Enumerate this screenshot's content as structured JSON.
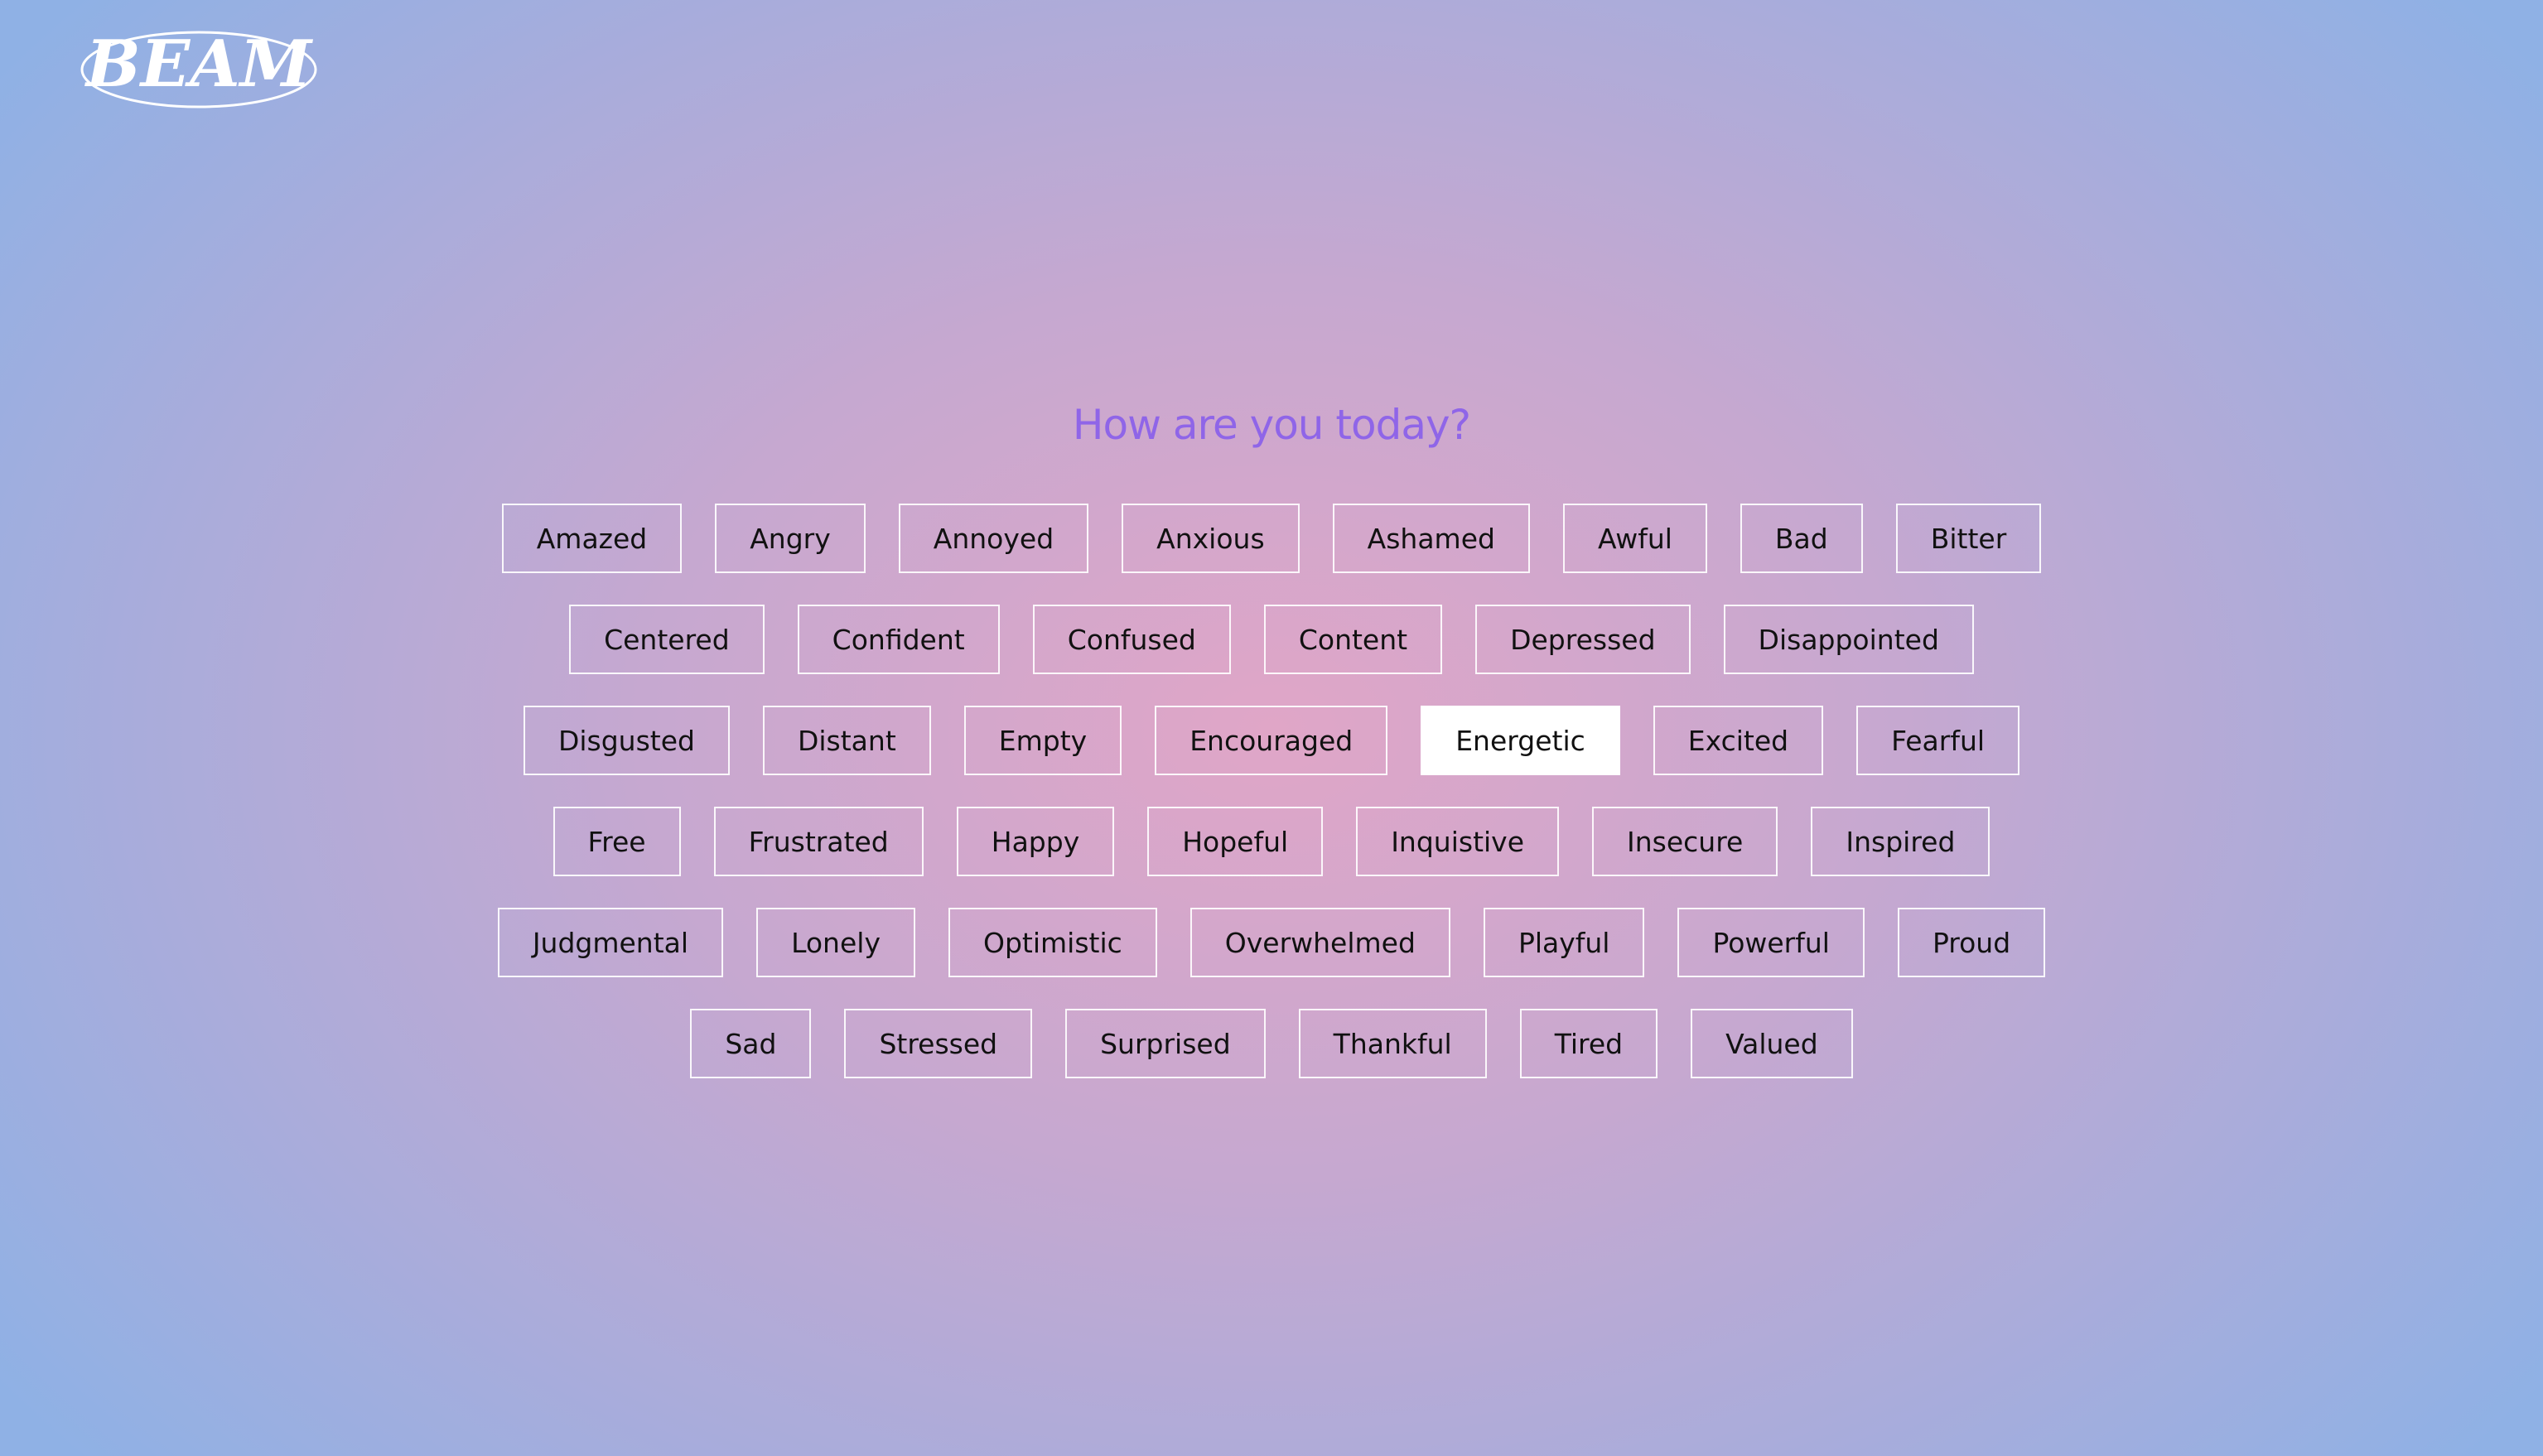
{
  "logo": {
    "text": "BEAM"
  },
  "question": "How are you today?",
  "emotion_rows": [
    [
      {
        "label": "Amazed"
      },
      {
        "label": "Angry"
      },
      {
        "label": "Annoyed"
      },
      {
        "label": "Anxious"
      },
      {
        "label": "Ashamed"
      },
      {
        "label": "Awful"
      },
      {
        "label": "Bad"
      },
      {
        "label": "Bitter"
      }
    ],
    [
      {
        "label": "Centered"
      },
      {
        "label": "Confident"
      },
      {
        "label": "Confused"
      },
      {
        "label": "Content"
      },
      {
        "label": "Depressed"
      },
      {
        "label": "Disappointed"
      }
    ],
    [
      {
        "label": "Disgusted"
      },
      {
        "label": "Distant"
      },
      {
        "label": "Empty"
      },
      {
        "label": "Encouraged"
      },
      {
        "label": "Energetic",
        "selected": true
      },
      {
        "label": "Excited"
      },
      {
        "label": "Fearful"
      }
    ],
    [
      {
        "label": "Free"
      },
      {
        "label": "Frustrated"
      },
      {
        "label": "Happy"
      },
      {
        "label": "Hopeful"
      },
      {
        "label": "Inquistive"
      },
      {
        "label": "Insecure"
      },
      {
        "label": "Inspired"
      }
    ],
    [
      {
        "label": "Judgmental"
      },
      {
        "label": "Lonely"
      },
      {
        "label": "Optimistic"
      },
      {
        "label": "Overwhelmed"
      },
      {
        "label": "Playful"
      },
      {
        "label": "Powerful"
      },
      {
        "label": "Proud"
      }
    ],
    [
      {
        "label": "Sad"
      },
      {
        "label": "Stressed"
      },
      {
        "label": "Surprised"
      },
      {
        "label": "Thankful"
      },
      {
        "label": "Tired"
      },
      {
        "label": "Valued"
      }
    ]
  ],
  "colors": {
    "question": "#8f65e8",
    "button_border": "#ffffff",
    "selected_background": "#ffffff",
    "button_text": "#111111"
  }
}
